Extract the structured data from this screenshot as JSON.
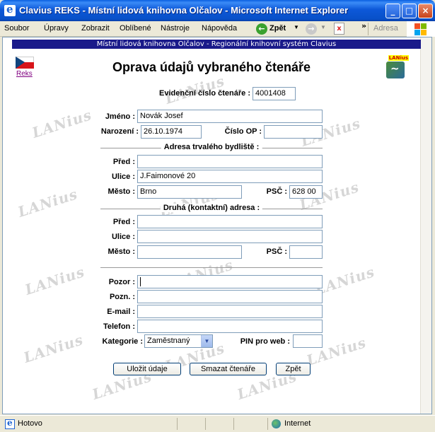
{
  "window": {
    "title": "Clavius REKS - Místní lidová knihovna Olčalov - Microsoft Internet Explorer",
    "buttons": {
      "minimize": "_",
      "maximize": "□",
      "close": "×"
    }
  },
  "menubar": {
    "items": [
      "Soubor",
      "Úpravy",
      "Zobrazit",
      "Oblíbené",
      "Nástroje",
      "Nápověda"
    ],
    "back_label": "Zpět",
    "address_label": "Adresa"
  },
  "page": {
    "banner": "Místní lidová knihovna Olčalov - Regionální knihovní systém Clavius",
    "reks_link": "Reks",
    "logo_tag": "LANius",
    "watermark": "LANius",
    "heading": "Oprava údajů vybraného čtenáře"
  },
  "form": {
    "reader_number_label": "Evidenční číslo čtenáře :",
    "reader_number": "4001408",
    "name_label": "Jméno :",
    "name": "Novák Josef",
    "birth_label": "Narození :",
    "birth": "26.10.1974",
    "id_label": "Číslo OP :",
    "id_value": "",
    "permanent_section": "Adresa trvalého bydliště :",
    "secondary_section": "Druhá (kontaktní) adresa :",
    "before_label": "Před :",
    "street_label": "Ulice :",
    "city_label": "Město :",
    "zip_label": "PSČ :",
    "permanent": {
      "before": "",
      "street": "J.Faimonové 20",
      "city": "Brno",
      "zip": "628 00"
    },
    "secondary": {
      "before": "",
      "street": "",
      "city": "",
      "zip": ""
    },
    "warning_label": "Pozor :",
    "warning": "",
    "note_label": "Pozn. :",
    "note": "",
    "email_label": "E-mail :",
    "email": "",
    "phone_label": "Telefon :",
    "phone": "",
    "category_label": "Kategorie :",
    "category": "Zaměstnaný",
    "pin_label": "PIN pro web :",
    "pin": ""
  },
  "buttons": {
    "save": "Uložit údaje",
    "delete": "Smazat čtenáře",
    "back": "Zpět"
  },
  "statusbar": {
    "status": "Hotovo",
    "zone": "Internet"
  }
}
